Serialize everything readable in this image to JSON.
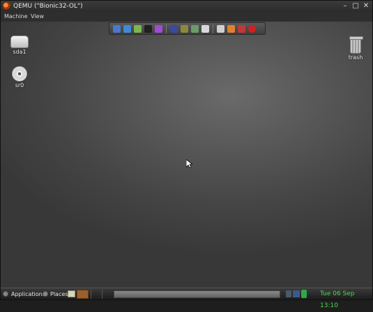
{
  "window": {
    "title": "QEMU (\"Bionic32-OL\")",
    "controls": {
      "minimize": "–",
      "maximize": "□",
      "close": "✕"
    }
  },
  "menubar": {
    "items": [
      "Machine",
      "View"
    ]
  },
  "dock": {
    "icons": [
      {
        "name": "home-icon",
        "color": "#4a78c8"
      },
      {
        "name": "browser-icon",
        "color": "#3d8ad6"
      },
      {
        "name": "chat-icon",
        "color": "#7ab848"
      },
      {
        "name": "terminal-icon",
        "color": "#202020"
      },
      {
        "name": "settings-purple-icon",
        "color": "#a34ad6"
      },
      {
        "name": "editor-icon",
        "color": "#3a4a9c"
      },
      {
        "name": "tools-icon",
        "color": "#8a8a3a"
      },
      {
        "name": "search-icon",
        "color": "#6a9c6a"
      },
      {
        "name": "document-icon",
        "color": "#d8d8d8"
      },
      {
        "name": "gear-icon",
        "color": "#cfcfcf"
      },
      {
        "name": "package-icon",
        "color": "#e08030"
      },
      {
        "name": "network-icon",
        "color": "#c03838"
      },
      {
        "name": "power-icon",
        "color": "#d02020"
      }
    ]
  },
  "desktop": {
    "icons": [
      {
        "label": "sda1",
        "icon": "drive-icon"
      },
      {
        "label": "sr0",
        "icon": "disc-icon"
      },
      {
        "label": "trash",
        "icon": "trash-icon"
      }
    ]
  },
  "panel": {
    "applications_label": "Applications",
    "places_label": "Places",
    "clock": "Tue 06 Sep 13:10"
  }
}
